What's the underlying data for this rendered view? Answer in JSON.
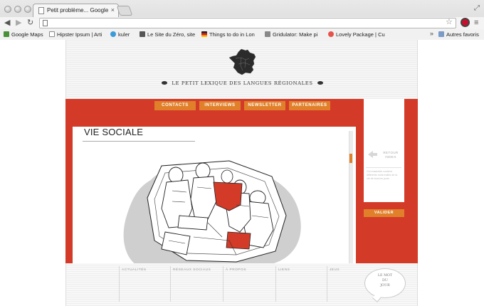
{
  "browser": {
    "tab_title": "Petit problème... Google Ch",
    "tab_close": "×",
    "address_value": "",
    "bookmarks": [
      {
        "label": "Google Maps",
        "color": "#4a8f3a"
      },
      {
        "label": "Hipster Ipsum | Arti",
        "color": "#ffffff"
      },
      {
        "label": "kuler",
        "color": "#3a9bd9"
      },
      {
        "label": "Le Site du Zéro, site",
        "color": "#555555"
      },
      {
        "label": "Things to do in Lon",
        "color": "#222222"
      },
      {
        "label": "Gridulator: Make pi",
        "color": "#888888"
      },
      {
        "label": "Lovely Package | Cu",
        "color": "#e5534b"
      }
    ],
    "more_bookmarks": "»",
    "other_bookmarks": "Autres favoris",
    "icons": [
      "back-arrow",
      "forward-arrow",
      "reload",
      "star",
      "stop-extension",
      "menu"
    ]
  },
  "site": {
    "title": "LE PETIT LEXIQUE DES LANGUES RÉGIONALES",
    "nav": [
      "CONTACTS",
      "INTERVIEWS",
      "NEWSLETTER",
      "PARTENAIRES"
    ],
    "section_title": "VIE SOCIALE",
    "sidebar": {
      "back_label": "RETOUR\nINDEX",
      "text": "Cet ensemble contient différents mots traités de la vie de tous les jours",
      "validate": "VALIDER"
    },
    "footer": {
      "links": [
        "ACTUALITÉS",
        "RÉSEAUX SOCIAUX",
        "À PROPOS",
        "LIENS",
        "JEUX"
      ],
      "bubble": "LE MOT\nDU\nJOUR"
    },
    "colors": {
      "brand_red": "#d33a27",
      "accent_orange": "#e0802a",
      "header_bg": "#f0f0f0"
    }
  }
}
